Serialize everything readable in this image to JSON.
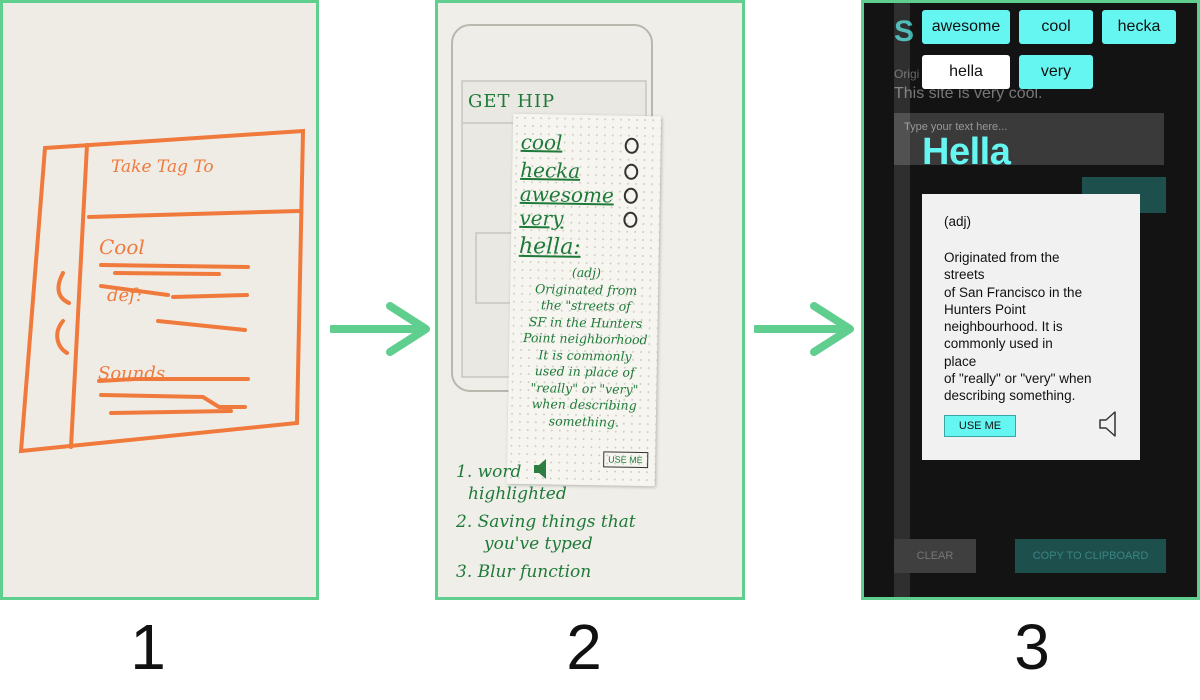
{
  "panels": {
    "p1": {
      "number": "1",
      "sketch": {
        "header": "Take Tag To",
        "word_cool": "Cool",
        "word_def": "def:",
        "word_sounds": "Sounds"
      }
    },
    "p2": {
      "number": "2",
      "paper_title": "GET HIP",
      "words": [
        "cool",
        "hecka",
        "awesome",
        "very"
      ],
      "hella_word": "hella:",
      "hella_definition": [
        "(adj)",
        "Originated from",
        "the \"streets of",
        "SF in the Hunters",
        "Point neighborhood",
        "It is commonly",
        "used in place of",
        "\"really\" or \"very\"",
        "when describing",
        "something."
      ],
      "use_me": "USE ME",
      "notes": [
        "1. word",
        "highlighted",
        "2. Saving things that",
        "you've typed",
        "3. Blur function"
      ]
    },
    "p3": {
      "number": "3",
      "chips": [
        "awesome",
        "cool",
        "hecka",
        "hella",
        "very"
      ],
      "app_title_partial": "S",
      "subtitle_partial": "Origi",
      "sentence_partial": "This site is very cool.",
      "input_placeholder": "Type your text here...",
      "word_title": "Hella",
      "pos": "(adj)",
      "definition_lines": [
        "Originated from the",
        "streets",
        "of San Francisco in the",
        "Hunters Point",
        "neighbourhood. It is",
        "commonly used in",
        "place",
        "of \"really\" or \"very\" when",
        "describing something."
      ],
      "use_me": "USE ME",
      "clear": "CLEAR",
      "copy": "COPY TO CLIPBOARD"
    }
  },
  "colors": {
    "frame": "#5fce8f",
    "arrow": "#5fce8f",
    "accent": "#66f6f2",
    "sketch": "#f07a3c",
    "ink": "#1f7a3a"
  },
  "icons": [
    "arrow-right-icon",
    "speaker-icon",
    "heart-icon"
  ]
}
